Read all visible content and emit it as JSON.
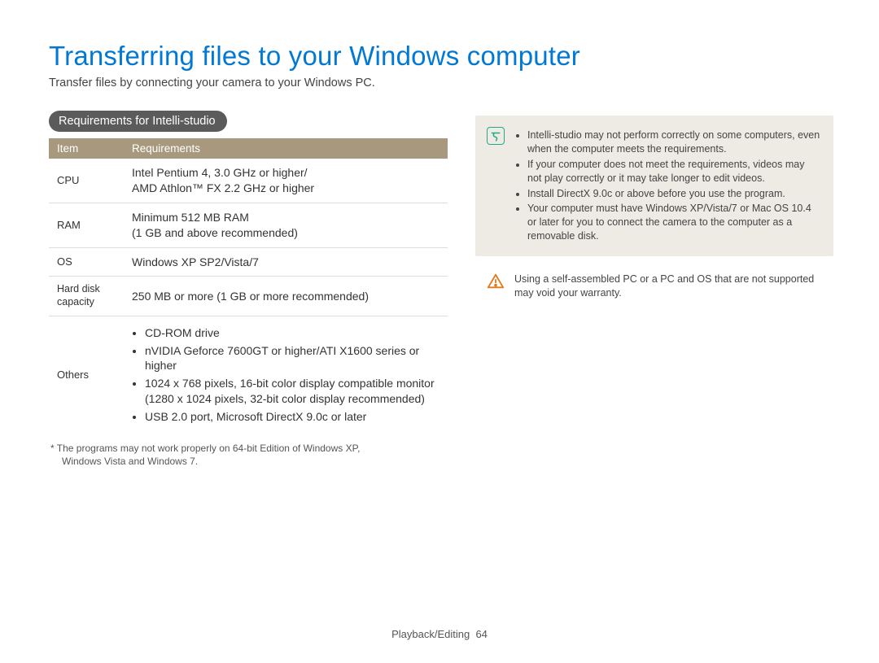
{
  "title": "Transferring files to your Windows computer",
  "intro": "Transfer files by connecting your camera to your Windows PC.",
  "section_label": "Requirements for Intelli-studio",
  "table": {
    "head": {
      "item": "Item",
      "req": "Requirements"
    },
    "rows": {
      "cpu": {
        "label": "CPU",
        "text": "Intel Pentium 4, 3.0 GHz or higher/\nAMD Athlon™ FX 2.2 GHz or higher"
      },
      "ram": {
        "label": "RAM",
        "text": "Minimum 512 MB RAM\n(1 GB and above recommended)"
      },
      "os": {
        "label": "OS",
        "text": "Windows XP SP2/Vista/7"
      },
      "hdd": {
        "label": "Hard disk capacity",
        "text": "250 MB or more (1 GB or more recommended)"
      },
      "others": {
        "label": "Others",
        "items": [
          "CD-ROM drive",
          "nVIDIA Geforce 7600GT or higher/ATI X1600 series or higher",
          "1024 x 768 pixels, 16-bit color display compatible monitor (1280 x 1024 pixels, 32-bit color display recommended)",
          "USB 2.0 port, Microsoft DirectX 9.0c or later"
        ]
      }
    }
  },
  "footnote_a": "* The programs may not work properly on 64-bit Edition of Windows XP,",
  "footnote_b": "Windows Vista and Windows 7.",
  "notes": [
    "Intelli-studio may not perform correctly on some computers, even when the computer meets the requirements.",
    "If your computer does not meet the requirements, videos may not play correctly or it may take longer to edit videos.",
    "Install DirectX 9.0c or above before you use the program.",
    "Your computer must have Windows XP/Vista/7 or Mac OS 10.4 or later for you to connect the camera to the computer as a removable disk."
  ],
  "warning": "Using a self-assembled PC or a PC and OS that are not supported may void your warranty.",
  "footer": {
    "section": "Playback/Editing",
    "page": "64"
  }
}
